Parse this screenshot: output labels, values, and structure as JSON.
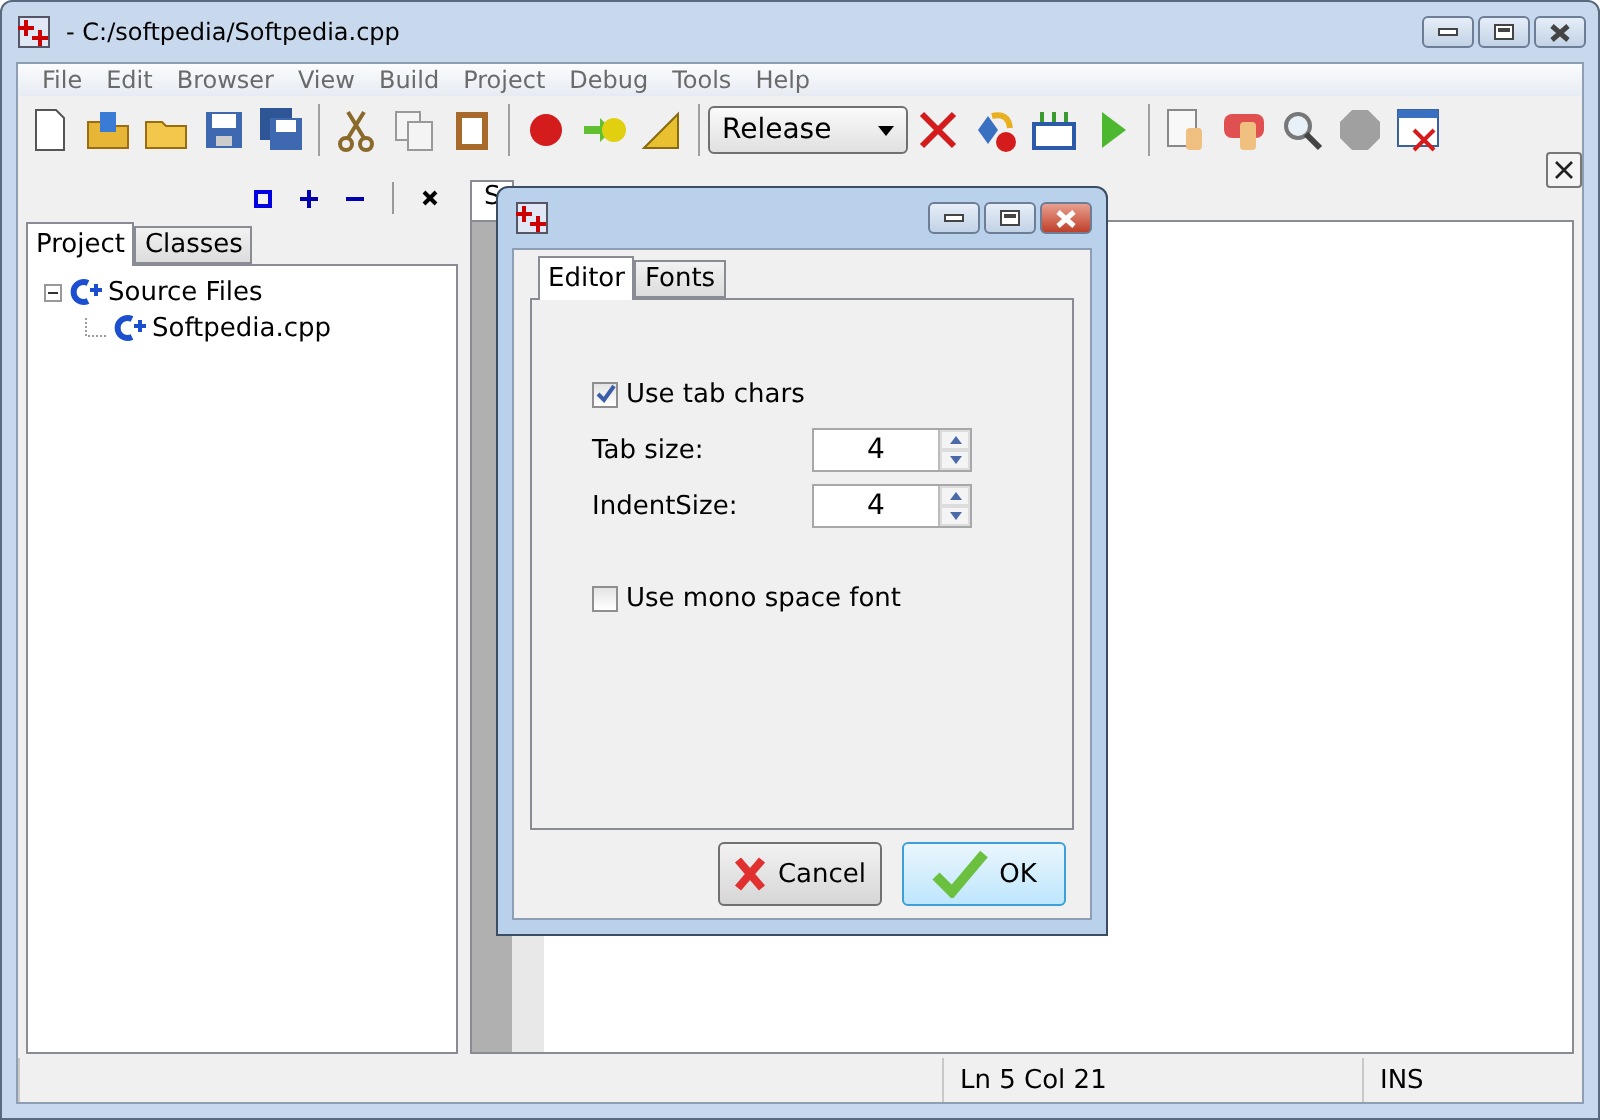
{
  "window": {
    "title": "- C:/softpedia/Softpedia.cpp"
  },
  "menu": [
    "File",
    "Edit",
    "Browser",
    "View",
    "Build",
    "Project",
    "Debug",
    "Tools",
    "Help"
  ],
  "toolbar": {
    "configuration": "Release"
  },
  "side_panel": {
    "tabs": [
      {
        "label": "Project",
        "selected": true
      },
      {
        "label": "Classes",
        "selected": false
      }
    ],
    "tree": [
      {
        "label": "Source Files",
        "expanded": true,
        "children": [
          {
            "label": "Softpedia.cpp"
          }
        ]
      }
    ]
  },
  "editor": {
    "tabs": [
      {
        "label": "S",
        "selected": true
      }
    ]
  },
  "dialog": {
    "tabs": [
      {
        "label": "Editor",
        "selected": true
      },
      {
        "label": "Fonts",
        "selected": false
      }
    ],
    "options": [
      {
        "kind": "checkbox",
        "label": "Use tab chars",
        "checked": true
      },
      {
        "kind": "spin",
        "label": "Tab size:",
        "value": "4"
      },
      {
        "kind": "spin",
        "label": "IndentSize:",
        "value": "4"
      },
      {
        "kind": "checkbox",
        "label": "Use mono space font",
        "checked": false
      }
    ],
    "buttons": [
      {
        "kind": "cancel",
        "label": "Cancel"
      },
      {
        "kind": "ok",
        "label": "OK"
      }
    ]
  },
  "status_bar": [
    "Ln 5  Col 21",
    "INS"
  ]
}
